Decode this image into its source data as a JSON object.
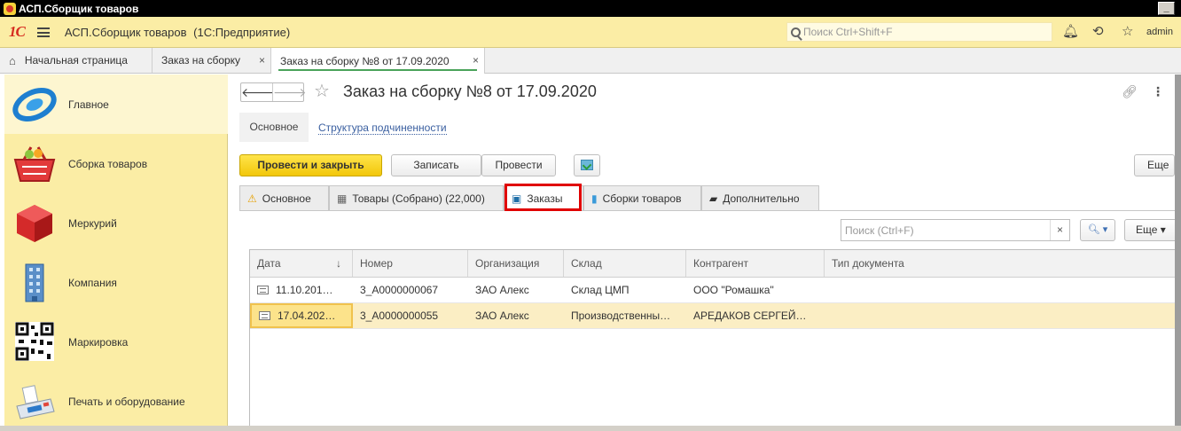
{
  "window": {
    "title": "АСП.Сборщик товаров",
    "minimize_label": "_"
  },
  "header": {
    "logo_text": "1С",
    "app_title": "АСП.Сборщик товаров",
    "app_subtitle": "(1С:Предприятие)",
    "search_placeholder": "Поиск Ctrl+Shift+F",
    "user": "admin"
  },
  "open_tabs": [
    {
      "label": "Начальная страница"
    },
    {
      "label": "Заказ на сборку",
      "close": "×"
    },
    {
      "label": "Заказ на сборку №8 от 17.09.2020",
      "close": "×"
    }
  ],
  "sidebar": {
    "items": [
      {
        "label": "Главное"
      },
      {
        "label": "Сборка товаров"
      },
      {
        "label": "Меркурий"
      },
      {
        "label": "Компания"
      },
      {
        "label": "Маркировка"
      },
      {
        "label": "Печать и оборудование"
      }
    ]
  },
  "document": {
    "title": "Заказ на сборку №8 от 17.09.2020",
    "subtabs": {
      "main": "Основное",
      "link": "Структура подчиненности"
    },
    "toolbar": {
      "post_close": "Провести и закрыть",
      "save": "Записать",
      "post": "Провести",
      "more": "Еще"
    },
    "tabs": [
      {
        "label": "Основное"
      },
      {
        "label": "Товары (Собрано) (22,000)"
      },
      {
        "label": "Заказы"
      },
      {
        "label": "Сборки товаров"
      },
      {
        "label": "Дополнительно"
      }
    ],
    "list": {
      "search_placeholder": "Поиск (Ctrl+F)",
      "clear": "×",
      "more": "Еще",
      "columns": [
        "Дата",
        "Номер",
        "Организация",
        "Склад",
        "Контрагент",
        "Тип документа"
      ],
      "rows": [
        {
          "date": "11.10.201…",
          "number": "3_А0000000067",
          "org": "ЗАО Алекс",
          "warehouse": "Склад ЦМП",
          "counterparty": "ООО \"Ромашка\"",
          "type": ""
        },
        {
          "date": "17.04.202…",
          "number": "3_А0000000055",
          "org": "ЗАО Алекс",
          "warehouse": "Производственны…",
          "counterparty": "АРЕДАКОВ СЕРГЕЙ…",
          "type": ""
        }
      ]
    }
  },
  "colors": {
    "accent_yellow": "#fbeda5",
    "primary_button": "#f2c70a",
    "highlight_red": "#e00000",
    "active_tab_underline": "#4aa35a"
  }
}
